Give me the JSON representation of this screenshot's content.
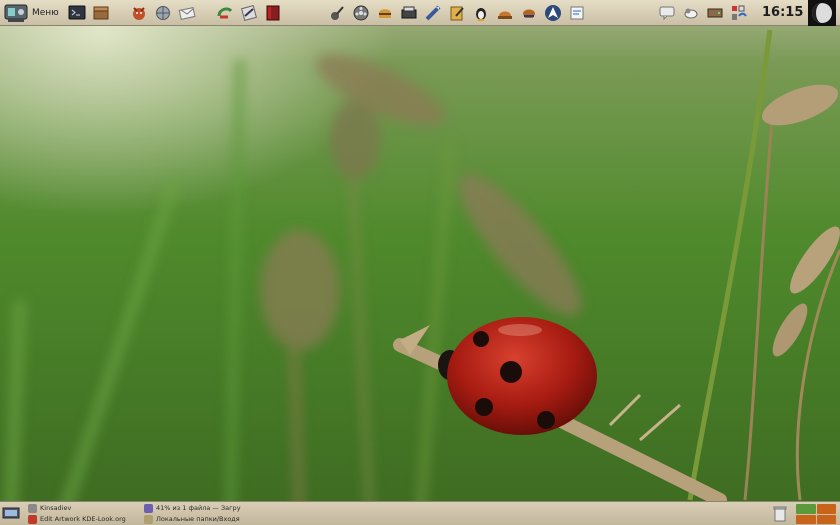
{
  "top_panel": {
    "menu_label": "Меню",
    "launchers": [
      {
        "icon": "terminal-icon"
      },
      {
        "icon": "package-icon"
      },
      {
        "icon": "fox-browser-icon"
      },
      {
        "icon": "globe-network-icon"
      },
      {
        "icon": "mail-icon"
      },
      {
        "icon": "update-arrow-icon"
      },
      {
        "icon": "text-editor-icon"
      },
      {
        "icon": "red-book-icon"
      },
      {
        "icon": "guitar-icon"
      },
      {
        "icon": "film-reel-icon"
      },
      {
        "icon": "burger-icon"
      },
      {
        "icon": "scanner-icon"
      },
      {
        "icon": "diagonal-tool-icon"
      },
      {
        "icon": "pencil-note-icon"
      },
      {
        "icon": "tux-icon"
      },
      {
        "icon": "oven-icon"
      },
      {
        "icon": "game-icon"
      },
      {
        "icon": "arch-logo-icon"
      },
      {
        "icon": "document-icon"
      }
    ],
    "tray": [
      {
        "icon": "chat-icon"
      },
      {
        "icon": "weather-cloud-icon"
      },
      {
        "icon": "hard-drive-icon"
      },
      {
        "icon": "system-tray-cluster-icon"
      }
    ],
    "clock": "16:15"
  },
  "bottom_panel": {
    "tasks": [
      {
        "label": "Kinsadiev",
        "icon_color": "#8a8a8a"
      },
      {
        "label": "Edit Artwork KDE-Look.org",
        "icon_color": "#c0392b"
      },
      {
        "label": "41% из 1 файла — Загру",
        "icon_color": "#6d5fb0"
      },
      {
        "label": "Локальные папки/Входя",
        "icon_color": "#b0a070"
      }
    ],
    "pager_colors": [
      "#5a9a3a",
      "#c8641a",
      "#c8641a",
      "#c8641a"
    ]
  },
  "colors": {
    "panel_top": "#e6ddc6",
    "panel_bottom": "#c3b89c",
    "ladybug": "#a81c12"
  }
}
